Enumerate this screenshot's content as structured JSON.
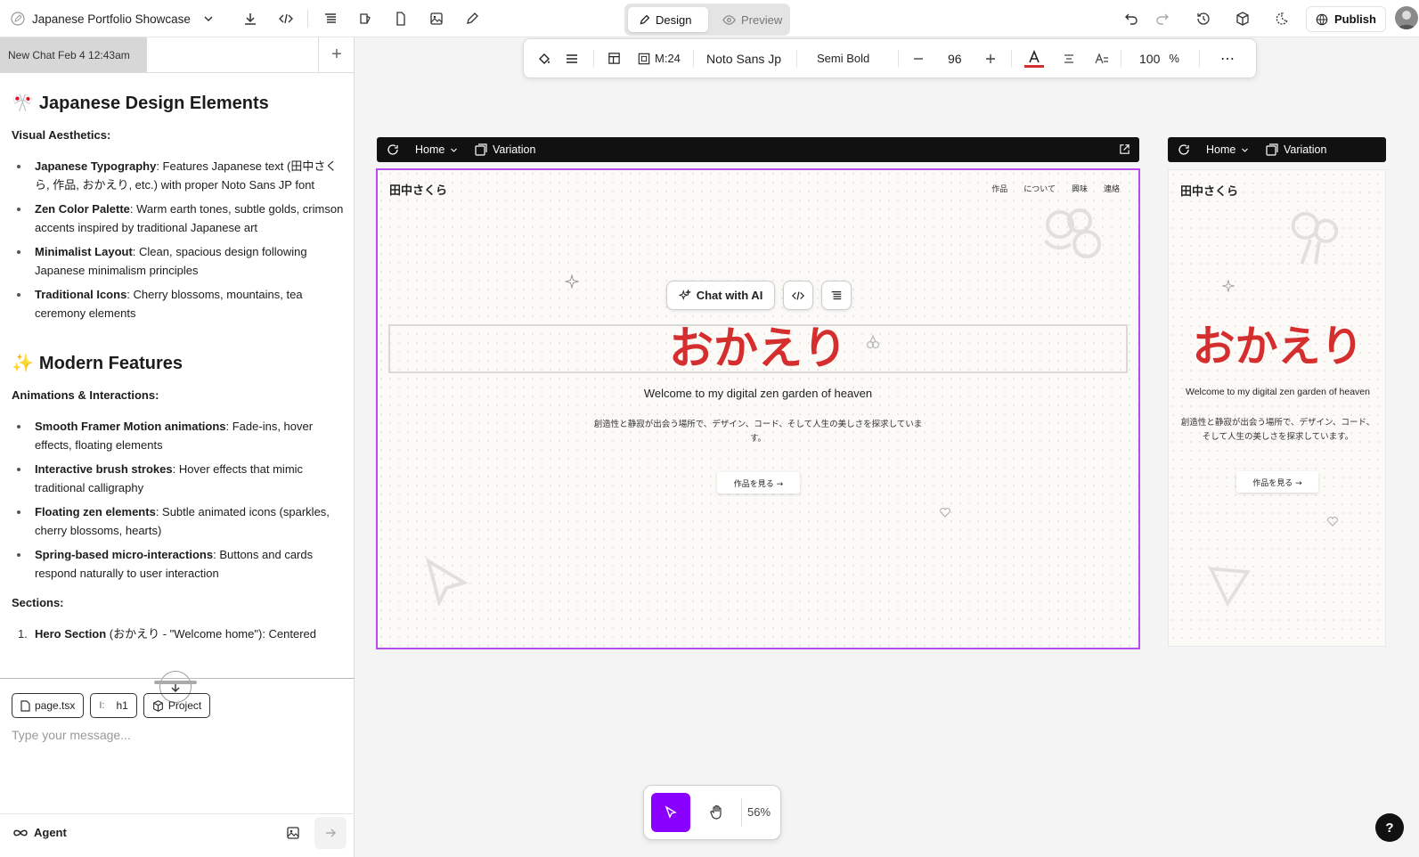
{
  "app": {
    "project_name": "Japanese Portfolio Showcase",
    "mode_tabs": {
      "design": "Design",
      "preview": "Preview"
    },
    "publish_label": "Publish"
  },
  "chat": {
    "tab_title": "New Chat Feb 4 12:43am",
    "sections": [
      {
        "emoji": "🎌",
        "heading": "Japanese Design Elements",
        "subheading": "Visual Aesthetics:",
        "items": [
          {
            "bold": "Japanese Typography",
            "text": ": Features Japanese text (田中さくら, 作品, おかえり, etc.) with proper Noto Sans JP font"
          },
          {
            "bold": "Zen Color Palette",
            "text": ": Warm earth tones, subtle golds, crimson accents inspired by traditional Japanese art"
          },
          {
            "bold": "Minimalist Layout",
            "text": ": Clean, spacious design following Japanese minimalism principles"
          },
          {
            "bold": "Traditional Icons",
            "text": ": Cherry blossoms, mountains, tea ceremony elements"
          }
        ]
      },
      {
        "emoji": "✨",
        "heading": "Modern Features",
        "subheading": "Animations & Interactions:",
        "items": [
          {
            "bold": "Smooth Framer Motion animations",
            "text": ": Fade-ins, hover effects, floating elements"
          },
          {
            "bold": "Interactive brush strokes",
            "text": ": Hover effects that mimic traditional calligraphy"
          },
          {
            "bold": "Floating zen elements",
            "text": ": Subtle animated icons (sparkles, cherry blossoms, hearts)"
          },
          {
            "bold": "Spring-based micro-interactions",
            "text": ": Buttons and cards respond naturally to user interaction"
          }
        ]
      }
    ],
    "sections_label": "Sections:",
    "ordered_item": {
      "bold": "Hero Section",
      "text": " (おかえり - \"Welcome home\"): Centered"
    },
    "context_chips": [
      "page.tsx",
      "h1",
      "Project"
    ],
    "input_placeholder": "Type your message...",
    "agent_label": "Agent"
  },
  "toolbar": {
    "margin": "M:24",
    "font_family": "Noto Sans Jp",
    "font_weight": "Semi Bold",
    "font_size": "96",
    "opacity": "100",
    "opacity_unit": "%",
    "text_color": "#d42e2e"
  },
  "frames": {
    "nav_home": "Home",
    "nav_variation": "Variation",
    "site": {
      "brand": "田中さくら",
      "nav_links": [
        "作品",
        "について",
        "興味",
        "連絡"
      ],
      "hero_title": "おかえり",
      "welcome": "Welcome to my digital zen garden of heaven",
      "description": "創造性と静寂が出会う場所で、デザイン、コード、そして人生の美しさを探求しています。",
      "cta": "作品を見る →"
    }
  },
  "floating": {
    "chat_ai": "Chat with AI"
  },
  "bottom": {
    "zoom": "56%"
  },
  "help": "?",
  "colors": {
    "accent": "#8a00ff",
    "selection": "#b44cf0",
    "hero": "#d42e2e"
  }
}
